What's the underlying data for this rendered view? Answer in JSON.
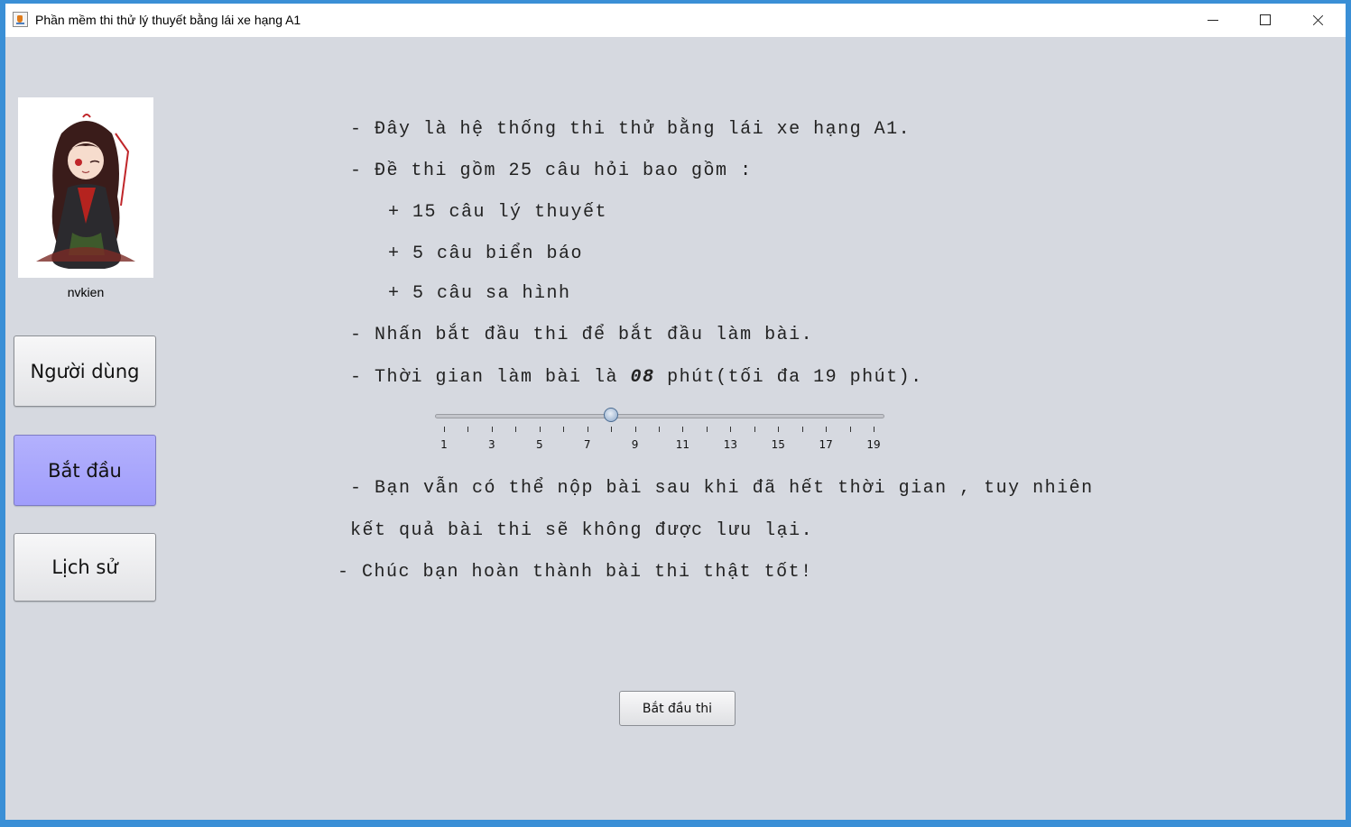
{
  "window": {
    "title": "Phần mềm thi thử lý thuyết bằng lái xe hạng A1",
    "icon": "java-cup-icon",
    "accent_color": "#3a8fd6",
    "background_color": "#d6d9e0"
  },
  "sidebar": {
    "username": "nvkien",
    "buttons": [
      {
        "label": "Người dùng",
        "active": false
      },
      {
        "label": "Bắt đầu",
        "active": true,
        "color": "#a8a6fc"
      },
      {
        "label": "Lịch sử",
        "active": false
      }
    ]
  },
  "main": {
    "lines": [
      "- Đây là hệ thống thi thử bằng lái xe hạng A1.",
      "- Đề thi gồm 25 câu hỏi bao gồm :",
      "+ 15 câu lý thuyết",
      "+ 5 câu biển báo",
      "+ 5 câu sa hình",
      "- Nhấn bắt đầu thi để bắt đầu làm bài."
    ],
    "time_prefix": "- Thời gian làm bài là ",
    "time_value": "08",
    "time_suffix": "phút(tối đa 19 phút).",
    "slider": {
      "min": 1,
      "max": 19,
      "value": 8,
      "tick_labels": [
        "1",
        "3",
        "5",
        "7",
        "9",
        "11",
        "13",
        "15",
        "17",
        "19"
      ]
    },
    "note_line_1": "- Bạn vẫn có thể nộp bài sau khi đã hết thời gian , tuy nhiên",
    "note_line_2": "kết quả bài thi sẽ không được lưu lại.",
    "wish_line": "- Chúc bạn hoàn thành bài thi thật tốt!",
    "start_button": "Bắt đầu thi"
  }
}
